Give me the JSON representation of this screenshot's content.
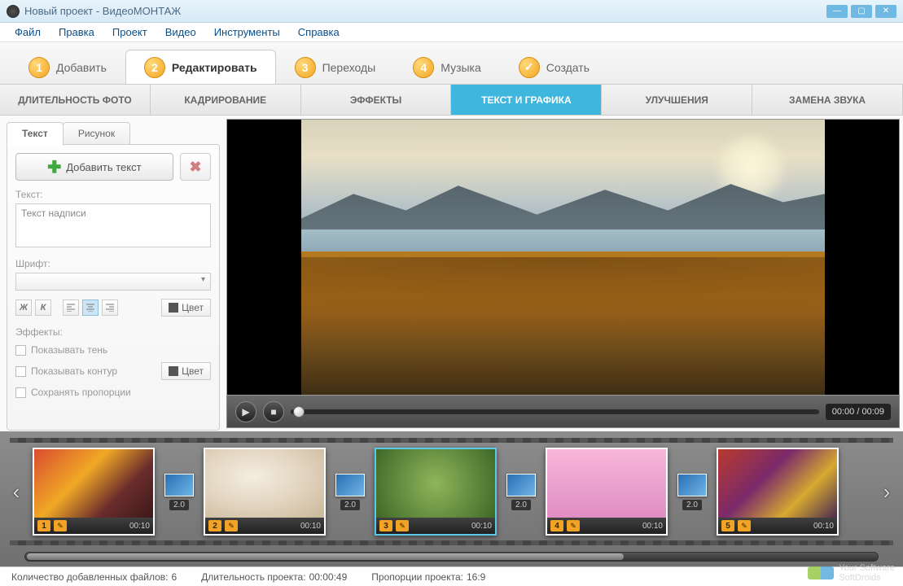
{
  "window": {
    "title": "Новый проект - ВидеоМОНТАЖ"
  },
  "menu": {
    "file": "Файл",
    "edit": "Правка",
    "project": "Проект",
    "video": "Видео",
    "tools": "Инструменты",
    "help": "Справка"
  },
  "steps": {
    "s1": "Добавить",
    "s2": "Редактировать",
    "s3": "Переходы",
    "s4": "Музыка",
    "s5": "Создать"
  },
  "subtabs": {
    "t1": "ДЛИТЕЛЬНОСТЬ ФОТО",
    "t2": "КАДРИРОВАНИЕ",
    "t3": "ЭФФЕКТЫ",
    "t4": "ТЕКСТ И ГРАФИКА",
    "t5": "УЛУЧШЕНИЯ",
    "t6": "ЗАМЕНА ЗВУКА"
  },
  "textpanel": {
    "tab_text": "Текст",
    "tab_image": "Рисунок",
    "add_text": "Добавить текст",
    "text_label": "Текст:",
    "text_value": "Текст надписи",
    "font_label": "Шрифт:",
    "bold": "Ж",
    "italic": "К",
    "color": "Цвет",
    "effects_label": "Эффекты:",
    "show_shadow": "Показывать тень",
    "show_outline": "Показывать контур",
    "keep_proportions": "Сохранять пропорции"
  },
  "player": {
    "time": "00:00 / 00:09"
  },
  "timeline": {
    "clips": [
      {
        "num": "1",
        "time": "00:10"
      },
      {
        "num": "2",
        "time": "00:10"
      },
      {
        "num": "3",
        "time": "00:10"
      },
      {
        "num": "4",
        "time": "00:10"
      },
      {
        "num": "5",
        "time": "00:10"
      }
    ],
    "transitions": [
      {
        "dur": "2.0"
      },
      {
        "dur": "2.0"
      },
      {
        "dur": "2.0"
      },
      {
        "dur": "2.0"
      }
    ]
  },
  "status": {
    "files_count_label": "Количество добавленных файлов:",
    "files_count": "6",
    "duration_label": "Длительность проекта:",
    "duration": "00:00:49",
    "aspect_label": "Пропорции проекта:",
    "aspect": "16:9"
  },
  "watermark": {
    "line1": "Your Software",
    "line2": "SoftDroids"
  }
}
